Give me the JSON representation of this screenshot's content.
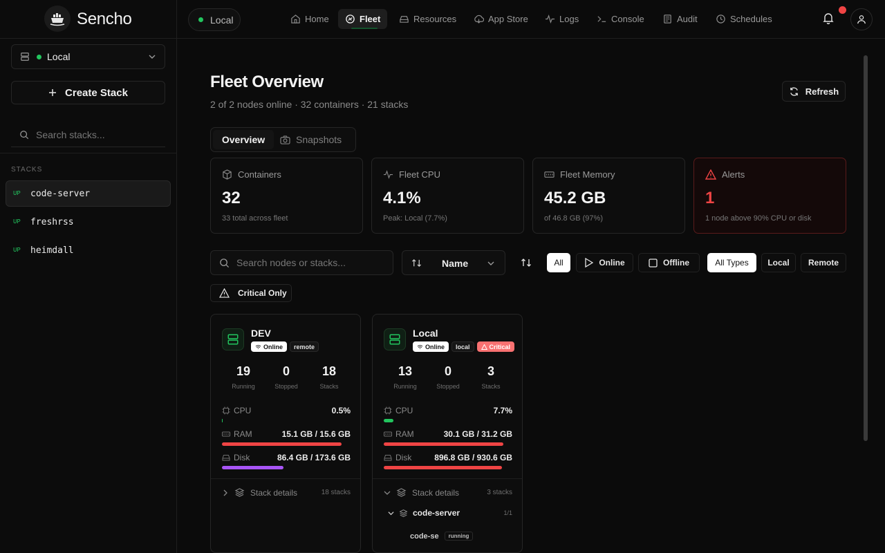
{
  "app": {
    "name": "Sencho"
  },
  "sidebar": {
    "node_select": {
      "label": "Local"
    },
    "create_label": "Create Stack",
    "search_placeholder": "Search stacks...",
    "stacks_heading": "STACKS",
    "stacks": [
      {
        "status": "UP",
        "name": "code-server"
      },
      {
        "status": "UP",
        "name": "freshrss"
      },
      {
        "status": "UP",
        "name": "heimdall"
      }
    ]
  },
  "topbar": {
    "node_pill": "Local",
    "nav": [
      {
        "label": "Home",
        "icon": "home-icon"
      },
      {
        "label": "Fleet",
        "icon": "fleet-icon"
      },
      {
        "label": "Resources",
        "icon": "resources-icon"
      },
      {
        "label": "App Store",
        "icon": "app-store-icon"
      },
      {
        "label": "Logs",
        "icon": "logs-icon"
      },
      {
        "label": "Console",
        "icon": "console-icon"
      },
      {
        "label": "Audit",
        "icon": "audit-icon"
      },
      {
        "label": "Schedules",
        "icon": "schedules-icon"
      }
    ],
    "active_nav": "Fleet"
  },
  "page": {
    "title": "Fleet Overview",
    "subtitle": "2 of 2 nodes online · 32 containers · 21 stacks",
    "refresh_label": "Refresh",
    "tabs": {
      "overview": "Overview",
      "snapshots": "Snapshots"
    }
  },
  "summary": {
    "containers": {
      "label": "Containers",
      "value": "32",
      "sub": "33 total across fleet"
    },
    "cpu": {
      "label": "Fleet CPU",
      "value": "4.1%",
      "sub": "Peak: Local (7.7%)"
    },
    "memory": {
      "label": "Fleet Memory",
      "value": "45.2 GB",
      "sub": "of 46.8 GB (97%)"
    },
    "alerts": {
      "label": "Alerts",
      "value": "1",
      "sub": "1 node above 90% CPU or disk"
    }
  },
  "filters": {
    "search_placeholder": "Search nodes or stacks...",
    "sort_value": "Name",
    "status": {
      "all": "All",
      "online": "Online",
      "offline": "Offline"
    },
    "type": {
      "all": "All Types",
      "local": "Local",
      "remote": "Remote"
    },
    "critical_only": "Critical Only"
  },
  "nodes": [
    {
      "name": "DEV",
      "badges": {
        "status": "Online",
        "type": "remote"
      },
      "stats": {
        "running": "19",
        "running_label": "Running",
        "stopped": "0",
        "stopped_label": "Stopped",
        "stacks": "18",
        "stacks_label": "Stacks"
      },
      "cpu": {
        "label": "CPU",
        "value": "0.5%",
        "fraction": 0.005,
        "color": "#22c55e"
      },
      "ram": {
        "label": "RAM",
        "value": "15.1 GB / 15.6 GB",
        "fraction": 0.968,
        "color": "#ef4444"
      },
      "disk": {
        "label": "Disk",
        "value": "86.4 GB / 173.6 GB",
        "fraction": 0.498,
        "color": "#a855f7"
      },
      "stack_details": {
        "label": "Stack details",
        "count": "18 stacks"
      }
    },
    {
      "name": "Local",
      "badges": {
        "status": "Online",
        "type": "local",
        "critical": "Critical"
      },
      "stats": {
        "running": "13",
        "running_label": "Running",
        "stopped": "0",
        "stopped_label": "Stopped",
        "stacks": "3",
        "stacks_label": "Stacks"
      },
      "cpu": {
        "label": "CPU",
        "value": "7.7%",
        "fraction": 0.077,
        "color": "#22c55e"
      },
      "ram": {
        "label": "RAM",
        "value": "30.1 GB / 31.2 GB",
        "fraction": 0.965,
        "color": "#ef4444"
      },
      "disk": {
        "label": "Disk",
        "value": "896.8 GB / 930.6 GB",
        "fraction": 0.964,
        "color": "#ef4444"
      },
      "stack_details": {
        "label": "Stack details",
        "count": "3 stacks"
      },
      "expanded_stack": {
        "name": "code-server",
        "count": "1/1",
        "container": "code-se",
        "state": "running"
      }
    }
  ],
  "colors": {
    "accent_green": "#22c55e",
    "danger": "#ef4444",
    "disk_purple": "#a855f7"
  }
}
